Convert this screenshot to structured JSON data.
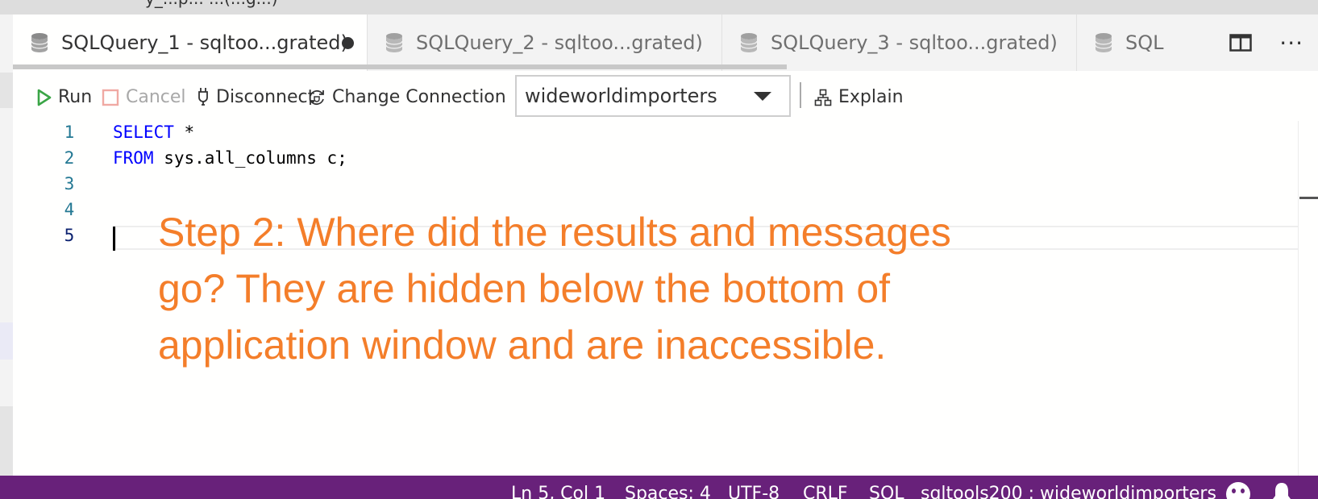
{
  "window": {
    "title_fragment": "y_...p... ...(...g...)"
  },
  "tabs": [
    {
      "label": "SQLQuery_1 - sqltoo...grated)",
      "icon": "database-icon",
      "active": true,
      "dirty": true
    },
    {
      "label": "SQLQuery_2 - sqltoo...grated)",
      "icon": "database-icon",
      "active": false,
      "dirty": false
    },
    {
      "label": "SQLQuery_3 - sqltoo...grated)",
      "icon": "database-icon",
      "active": false,
      "dirty": false
    },
    {
      "label": "SQL",
      "icon": "database-icon",
      "active": false,
      "dirty": false
    }
  ],
  "tab_actions": {
    "split_icon": "split-editor-icon",
    "more_label": "···"
  },
  "toolbar": {
    "run_label": "Run",
    "cancel_label": "Cancel",
    "disconnect_label": "Disconnect",
    "change_connection_label": "Change Connection",
    "database": "wideworldimporters",
    "explain_label": "Explain"
  },
  "editor": {
    "line_numbers": [
      "1",
      "2",
      "3",
      "4",
      "5"
    ],
    "lines": [
      {
        "keyword": "SELECT",
        "rest": " *"
      },
      {
        "keyword": "FROM",
        "rest": " sys.all_columns c;"
      },
      {
        "keyword": "",
        "rest": ""
      },
      {
        "keyword": "",
        "rest": ""
      },
      {
        "keyword": "",
        "rest": ""
      }
    ],
    "cursor_line": 5
  },
  "annotation": {
    "line1": "Step 2: Where did the results and messages",
    "line2": "go?  They are hidden below the bottom of",
    "line3": "application window and are inaccessible.",
    "color": "#f47e2a"
  },
  "statusbar": {
    "position": "Ln 5, Col 1",
    "spaces": "Spaces: 4",
    "encoding": "UTF-8",
    "eol": "CRLF",
    "language": "SQL",
    "connection": "sqltools200 : wideworldimporters",
    "background": "#68217a"
  }
}
